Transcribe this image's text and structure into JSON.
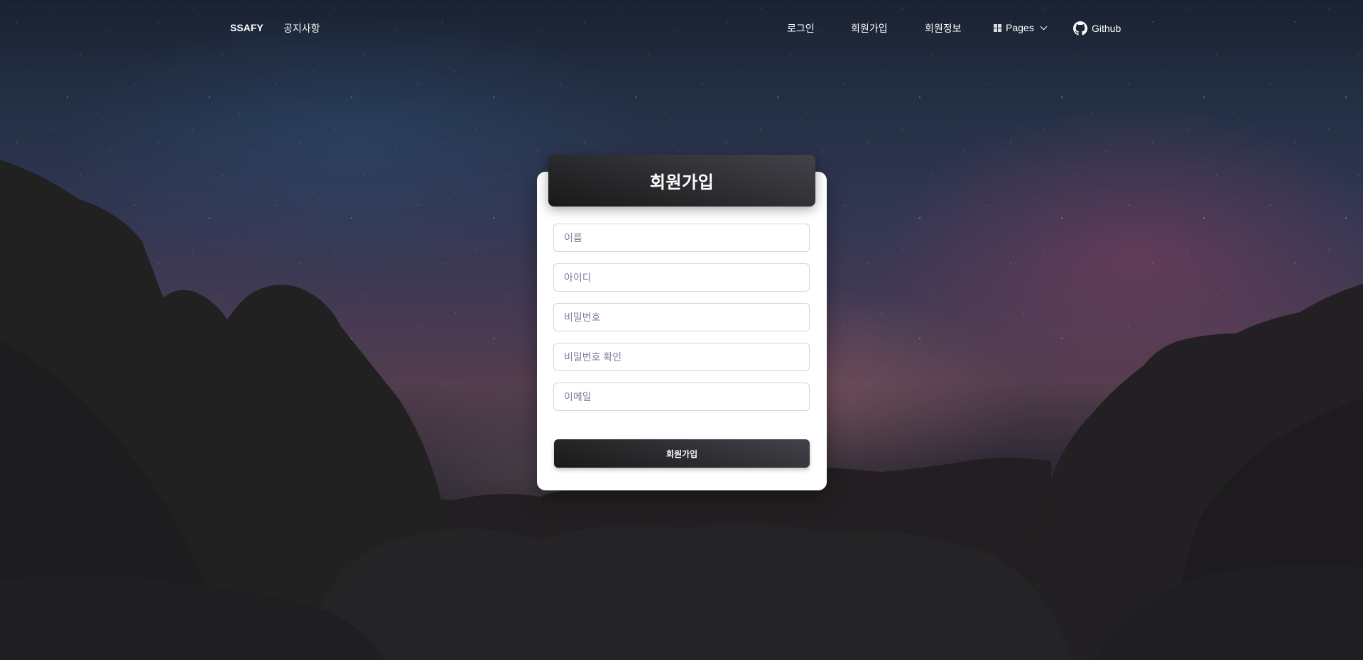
{
  "navbar": {
    "brand": "SSAFY",
    "left_links": [
      {
        "label": "공지사항"
      }
    ],
    "right_links": [
      {
        "label": "로그인"
      },
      {
        "label": "회원가입"
      },
      {
        "label": "회원정보"
      }
    ],
    "pages_label": "Pages",
    "pages_icon": "dashboard-icon",
    "github_label": "Github",
    "github_icon": "github-icon"
  },
  "signup": {
    "title": "회원가입",
    "fields": {
      "name": {
        "placeholder": "이름",
        "value": ""
      },
      "username": {
        "placeholder": "아이디",
        "value": ""
      },
      "password": {
        "placeholder": "비밀번호",
        "value": ""
      },
      "password_confirm": {
        "placeholder": "비밀번호 확인",
        "value": ""
      },
      "email": {
        "placeholder": "이메일",
        "value": ""
      }
    },
    "submit_label": "회원가입"
  },
  "colors": {
    "card_bg": "#ffffff",
    "header_gradient_start": "#42424a",
    "header_gradient_end": "#191919",
    "input_border": "#d2d6da",
    "placeholder": "#7b809a"
  }
}
